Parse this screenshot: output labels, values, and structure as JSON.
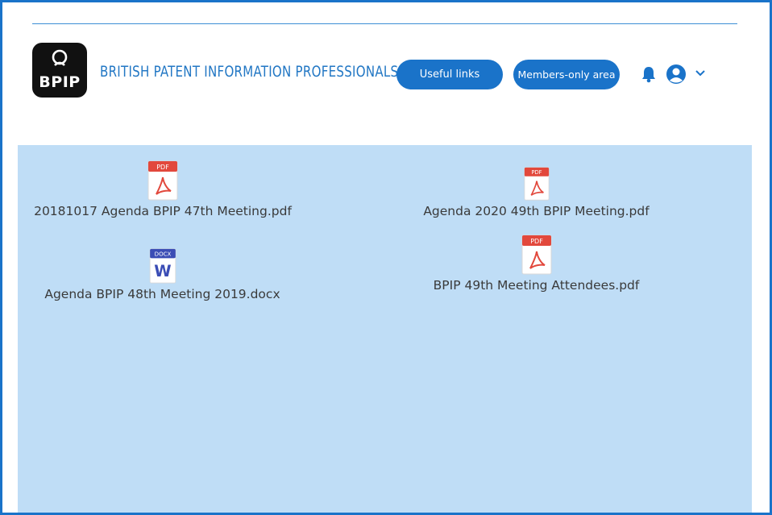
{
  "header": {
    "logo_text": "BPIP",
    "site_title": "BRITISH PATENT INFORMATION PROFESSIONALS",
    "nav": {
      "useful_links_label": "Useful links",
      "members_area_label": "Members-only area"
    },
    "icons": [
      "bell-icon",
      "user-avatar-icon",
      "chevron-down-icon"
    ]
  },
  "files": [
    {
      "name": "20181017 Agenda BPIP 47th Meeting.pdf",
      "type": "PDF",
      "badge": "PDF"
    },
    {
      "name": "Agenda 2020 49th BPIP Meeting.pdf",
      "type": "PDF",
      "badge": "PDF"
    },
    {
      "name": "Agenda BPIP 48th Meeting 2019.docx",
      "type": "DOCX",
      "badge": "DOCX"
    },
    {
      "name": "BPIP 49th Meeting Attendees.pdf",
      "type": "PDF",
      "badge": "PDF"
    }
  ],
  "colors": {
    "accent": "#1a73c9",
    "panel_bg": "#bfddf6",
    "pdf_red": "#e2483c",
    "docx_blue": "#3b4db5"
  }
}
